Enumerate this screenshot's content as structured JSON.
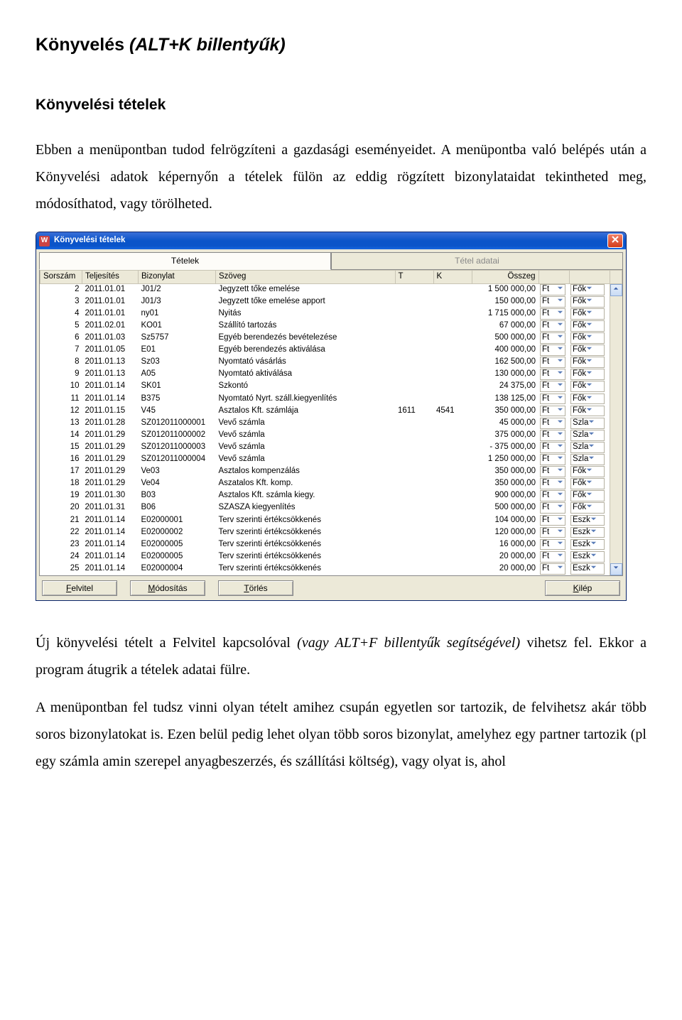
{
  "doc": {
    "heading_main": "Könyvelés ",
    "heading_main_italic": "(ALT+K billentyűk)",
    "heading_sub": "Könyvelési tételek",
    "para1": "Ebben a menüpontban tudod felrögzíteni a gazdasági eseményeidet. A menüpontba való belépés után a Könyvelési adatok képernyőn a tételek fülön az eddig rögzített bizonylataidat tekintheted meg, módosíthatod, vagy törölheted.",
    "para2a": "Új könyvelési tételt a Felvitel kapcsolóval ",
    "para2italic": "(vagy ALT+F billentyűk segítségével)",
    "para2b": " vihetsz fel. Ekkor a program átugrik a tételek adatai fülre.",
    "para3": "A menüpontban fel tudsz vinni olyan tételt amihez csupán egyetlen sor tartozik, de felvihetsz akár több soros bizonylatokat is. Ezen belül pedig lehet olyan több soros bizonylat, amelyhez egy partner tartozik (pl egy számla amin szerepel anyagbeszerzés, és szállítási költség), vagy olyat is, ahol"
  },
  "window": {
    "title": "Könyvelési tételek",
    "tabs": {
      "active": "Tételek",
      "inactive": "Tétel adatai"
    },
    "columns": [
      "Sorszám",
      "Teljesítés",
      "Bizonylat",
      "Szöveg",
      "T",
      "K",
      "Összeg"
    ],
    "unit": "Ft",
    "types": {
      "fok": "Fők",
      "szla": "Szla",
      "eszk": "Eszk"
    },
    "buttons": {
      "felvitel": "Felvitel",
      "felvitel_u": "F",
      "modositas": "Módosítás",
      "modositas_u": "M",
      "torles": "Törlés",
      "torles_u": "T",
      "kilep": "Kilép",
      "kilep_u": "K"
    },
    "rows": [
      {
        "n": "2",
        "d": "2011.01.01",
        "b": "J01/2",
        "s": "Jegyzett tőke emelése",
        "t": "",
        "k": "",
        "o": "1 500 000,00",
        "typ": "fok"
      },
      {
        "n": "3",
        "d": "2011.01.01",
        "b": "J01/3",
        "s": "Jegyzett tőke emelése apport",
        "t": "",
        "k": "",
        "o": "150 000,00",
        "typ": "fok"
      },
      {
        "n": "4",
        "d": "2011.01.01",
        "b": "ny01",
        "s": "Nyitás",
        "t": "",
        "k": "",
        "o": "1 715 000,00",
        "typ": "fok"
      },
      {
        "n": "5",
        "d": "2011.02.01",
        "b": "KO01",
        "s": "Szállító tartozás",
        "t": "",
        "k": "",
        "o": "67 000,00",
        "typ": "fok"
      },
      {
        "n": "6",
        "d": "2011.01.03",
        "b": "Sz5757",
        "s": "Egyéb berendezés bevételezése",
        "t": "",
        "k": "",
        "o": "500 000,00",
        "typ": "fok"
      },
      {
        "n": "7",
        "d": "2011.01.05",
        "b": "E01",
        "s": "Egyéb berendezés aktiválása",
        "t": "",
        "k": "",
        "o": "400 000,00",
        "typ": "fok"
      },
      {
        "n": "8",
        "d": "2011.01.13",
        "b": "Sz03",
        "s": "Nyomtató vásárlás",
        "t": "",
        "k": "",
        "o": "162 500,00",
        "typ": "fok"
      },
      {
        "n": "9",
        "d": "2011.01.13",
        "b": "A05",
        "s": "Nyomtató aktiválása",
        "t": "",
        "k": "",
        "o": "130 000,00",
        "typ": "fok"
      },
      {
        "n": "10",
        "d": "2011.01.14",
        "b": "SK01",
        "s": "Szkontó",
        "t": "",
        "k": "",
        "o": "24 375,00",
        "typ": "fok"
      },
      {
        "n": "11",
        "d": "2011.01.14",
        "b": "B375",
        "s": "Nyomtató Nyrt. száll.kiegyenlítés",
        "t": "",
        "k": "",
        "o": "138 125,00",
        "typ": "fok"
      },
      {
        "n": "12",
        "d": "2011.01.15",
        "b": "V45",
        "s": "Asztalos Kft. számlája",
        "t": "1611",
        "k": "4541",
        "o": "350 000,00",
        "typ": "fok"
      },
      {
        "n": "13",
        "d": "2011.01.28",
        "b": "SZ012011000001",
        "s": "Vevő számla",
        "t": "",
        "k": "",
        "o": "45 000,00",
        "typ": "szla"
      },
      {
        "n": "14",
        "d": "2011.01.29",
        "b": "SZ012011000002",
        "s": "Vevő számla",
        "t": "",
        "k": "",
        "o": "375 000,00",
        "typ": "szla"
      },
      {
        "n": "15",
        "d": "2011.01.29",
        "b": "SZ012011000003",
        "s": "Vevő számla",
        "t": "",
        "k": "",
        "o": "- 375 000,00",
        "typ": "szla"
      },
      {
        "n": "16",
        "d": "2011.01.29",
        "b": "SZ012011000004",
        "s": "Vevő számla",
        "t": "",
        "k": "",
        "o": "1 250 000,00",
        "typ": "szla"
      },
      {
        "n": "17",
        "d": "2011.01.29",
        "b": "Ve03",
        "s": "Asztalos kompenzálás",
        "t": "",
        "k": "",
        "o": "350 000,00",
        "typ": "fok"
      },
      {
        "n": "18",
        "d": "2011.01.29",
        "b": "Ve04",
        "s": "Aszatalos Kft. komp.",
        "t": "",
        "k": "",
        "o": "350 000,00",
        "typ": "fok"
      },
      {
        "n": "19",
        "d": "2011.01.30",
        "b": "B03",
        "s": "Asztalos Kft. számla kiegy.",
        "t": "",
        "k": "",
        "o": "900 000,00",
        "typ": "fok"
      },
      {
        "n": "20",
        "d": "2011.01.31",
        "b": "B06",
        "s": "SZASZA kiegyenlítés",
        "t": "",
        "k": "",
        "o": "500 000,00",
        "typ": "fok"
      },
      {
        "n": "21",
        "d": "2011.01.14",
        "b": "E02000001",
        "s": "Terv szerinti értékcsökkenés",
        "t": "",
        "k": "",
        "o": "104 000,00",
        "typ": "eszk"
      },
      {
        "n": "22",
        "d": "2011.01.14",
        "b": "E02000002",
        "s": "Terv szerinti értékcsökkenés",
        "t": "",
        "k": "",
        "o": "120 000,00",
        "typ": "eszk"
      },
      {
        "n": "23",
        "d": "2011.01.14",
        "b": "E02000005",
        "s": "Terv szerinti értékcsökkenés",
        "t": "",
        "k": "",
        "o": "16 000,00",
        "typ": "eszk"
      },
      {
        "n": "24",
        "d": "2011.01.14",
        "b": "E02000005",
        "s": "Terv szerinti értékcsökkenés",
        "t": "",
        "k": "",
        "o": "20 000,00",
        "typ": "eszk"
      },
      {
        "n": "25",
        "d": "2011.01.14",
        "b": "E02000004",
        "s": "Terv szerinti értékcsökkenés",
        "t": "",
        "k": "",
        "o": "20 000,00",
        "typ": "eszk"
      }
    ]
  }
}
